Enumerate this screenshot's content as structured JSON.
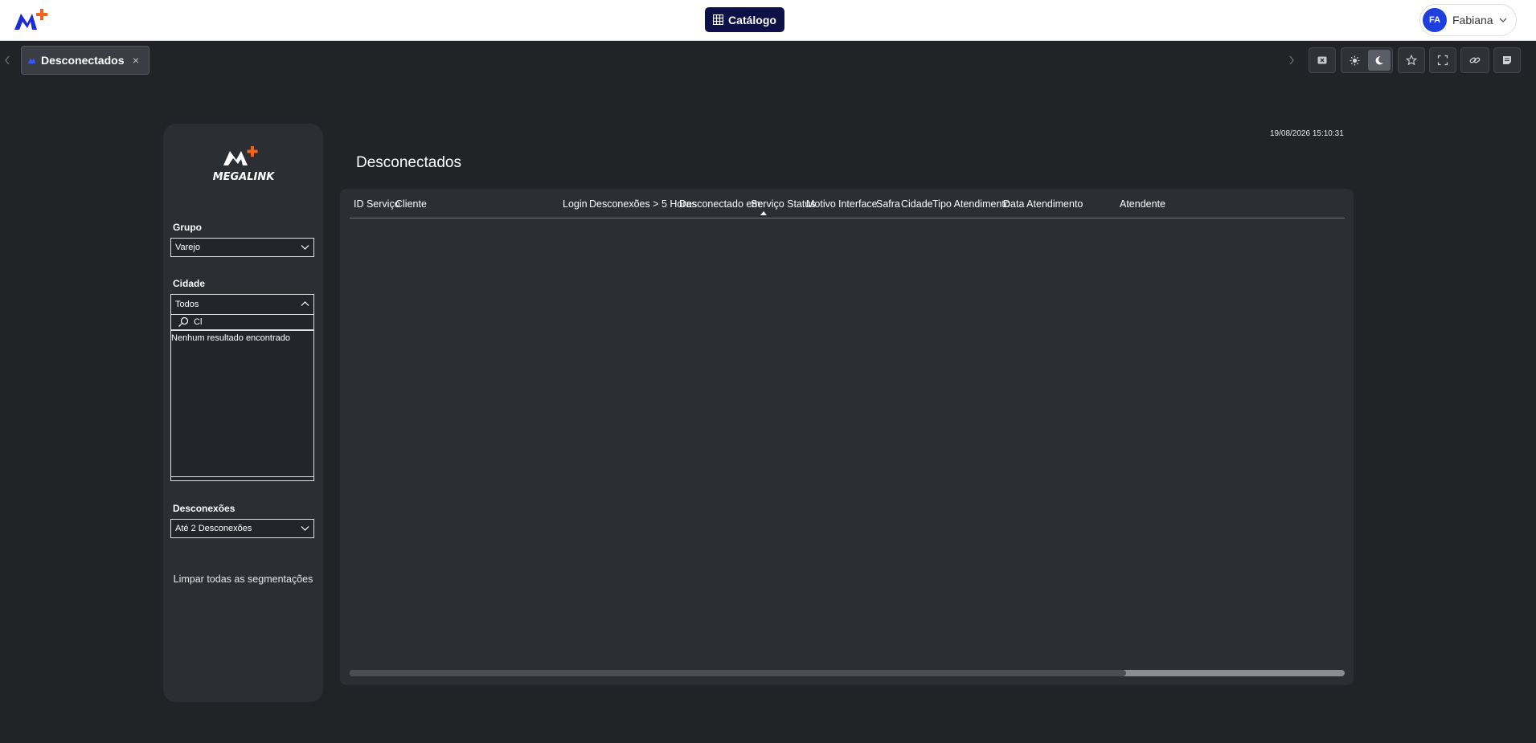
{
  "header": {
    "catalog_label": "Catálogo",
    "user": {
      "initials": "FA",
      "name": "Fabiana"
    }
  },
  "tabs": [
    {
      "label": "Desconectados",
      "close": "×"
    }
  ],
  "toolbar": {
    "icons": [
      "close-x-icon",
      "sun-icon",
      "moon-icon",
      "star-icon",
      "fullscreen-icon",
      "link-icon",
      "notes-icon"
    ],
    "theme_active": "dark"
  },
  "filters": {
    "brand": "MEGALINK",
    "grupo": {
      "label": "Grupo",
      "value": "Varejo"
    },
    "cidade": {
      "label": "Cidade",
      "value": "Todos",
      "search_value": "Cl",
      "no_result": "Nenhum resultado encontrado"
    },
    "desconexoes": {
      "label": "Desconexões",
      "value": "Até 2 Desconexões"
    },
    "clear_label": "Limpar todas as segmentações"
  },
  "report": {
    "timestamp": "19/08/2026 15:10:31",
    "title": "Desconectados",
    "columns": [
      "ID Serviço",
      "Cliente",
      "Login",
      "Desconexões > 5 Horas",
      "Desconectado em:",
      "Serviço Status",
      "Motivo",
      "Interface",
      "Safra",
      "Cidade",
      "Tipo Atendimento",
      "Data Atendimento",
      "Atendente"
    ],
    "sorted_column": "Desconectado em:",
    "scroll_position": 0.78
  },
  "colors": {
    "accent": "#0e1147",
    "avatar": "#1f3ee0",
    "brand_orange": "#f2621c",
    "header_rule": "#2f7fe0"
  }
}
